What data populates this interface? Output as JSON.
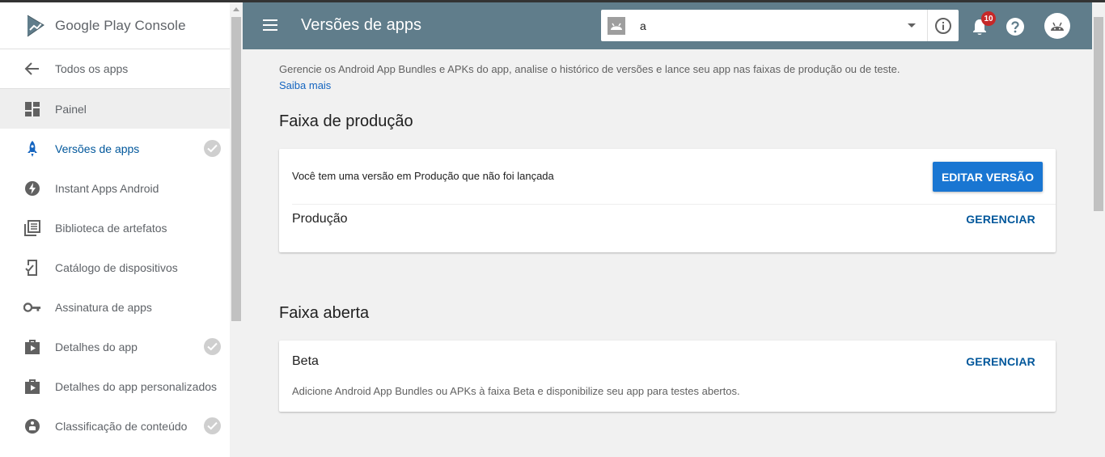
{
  "brand": {
    "text_google_play": "Google Play",
    "text_console": "Console"
  },
  "sidebar": {
    "back_label": "Todos os apps",
    "items": [
      {
        "label": "Painel",
        "icon": "dashboard-icon",
        "checked": false
      },
      {
        "label": "Versões de apps",
        "icon": "rocket-icon",
        "checked": true,
        "active": true
      },
      {
        "label": "Instant Apps Android",
        "icon": "bolt-icon",
        "checked": false
      },
      {
        "label": "Biblioteca de artefatos",
        "icon": "library-icon",
        "checked": false
      },
      {
        "label": "Catálogo de dispositivos",
        "icon": "device-catalog-icon",
        "checked": false
      },
      {
        "label": "Assinatura de apps",
        "icon": "key-icon",
        "checked": false
      },
      {
        "label": "Detalhes do app",
        "icon": "store-icon",
        "checked": true
      },
      {
        "label": "Detalhes do app personalizados",
        "icon": "store-icon",
        "checked": false
      },
      {
        "label": "Classificação de conteúdo",
        "icon": "content-rating-icon",
        "checked": true
      }
    ]
  },
  "header": {
    "title": "Versões de apps",
    "app_selector_value": "a",
    "notification_count": "10"
  },
  "main": {
    "description": "Gerencie os Android App Bundles e APKs do app, analise o histórico de versões e lance seu app nas faixas de produção ou de teste.",
    "learn_more": "Saiba mais",
    "production": {
      "section_title": "Faixa de produção",
      "message": "Você tem uma versão em Produção que não foi lançada",
      "edit_button": "EDITAR VERSÃO",
      "track_name": "Produção",
      "manage_label": "GERENCIAR"
    },
    "open": {
      "section_title": "Faixa aberta",
      "track_name": "Beta",
      "manage_label": "GERENCIAR",
      "note": "Adicione Android App Bundles ou APKs à faixa Beta e disponibilize seu app para testes abertos."
    }
  },
  "colors": {
    "header": "#607d8b",
    "accent": "#1976d2",
    "link": "#01579b",
    "active_icon": "#1565c0"
  }
}
